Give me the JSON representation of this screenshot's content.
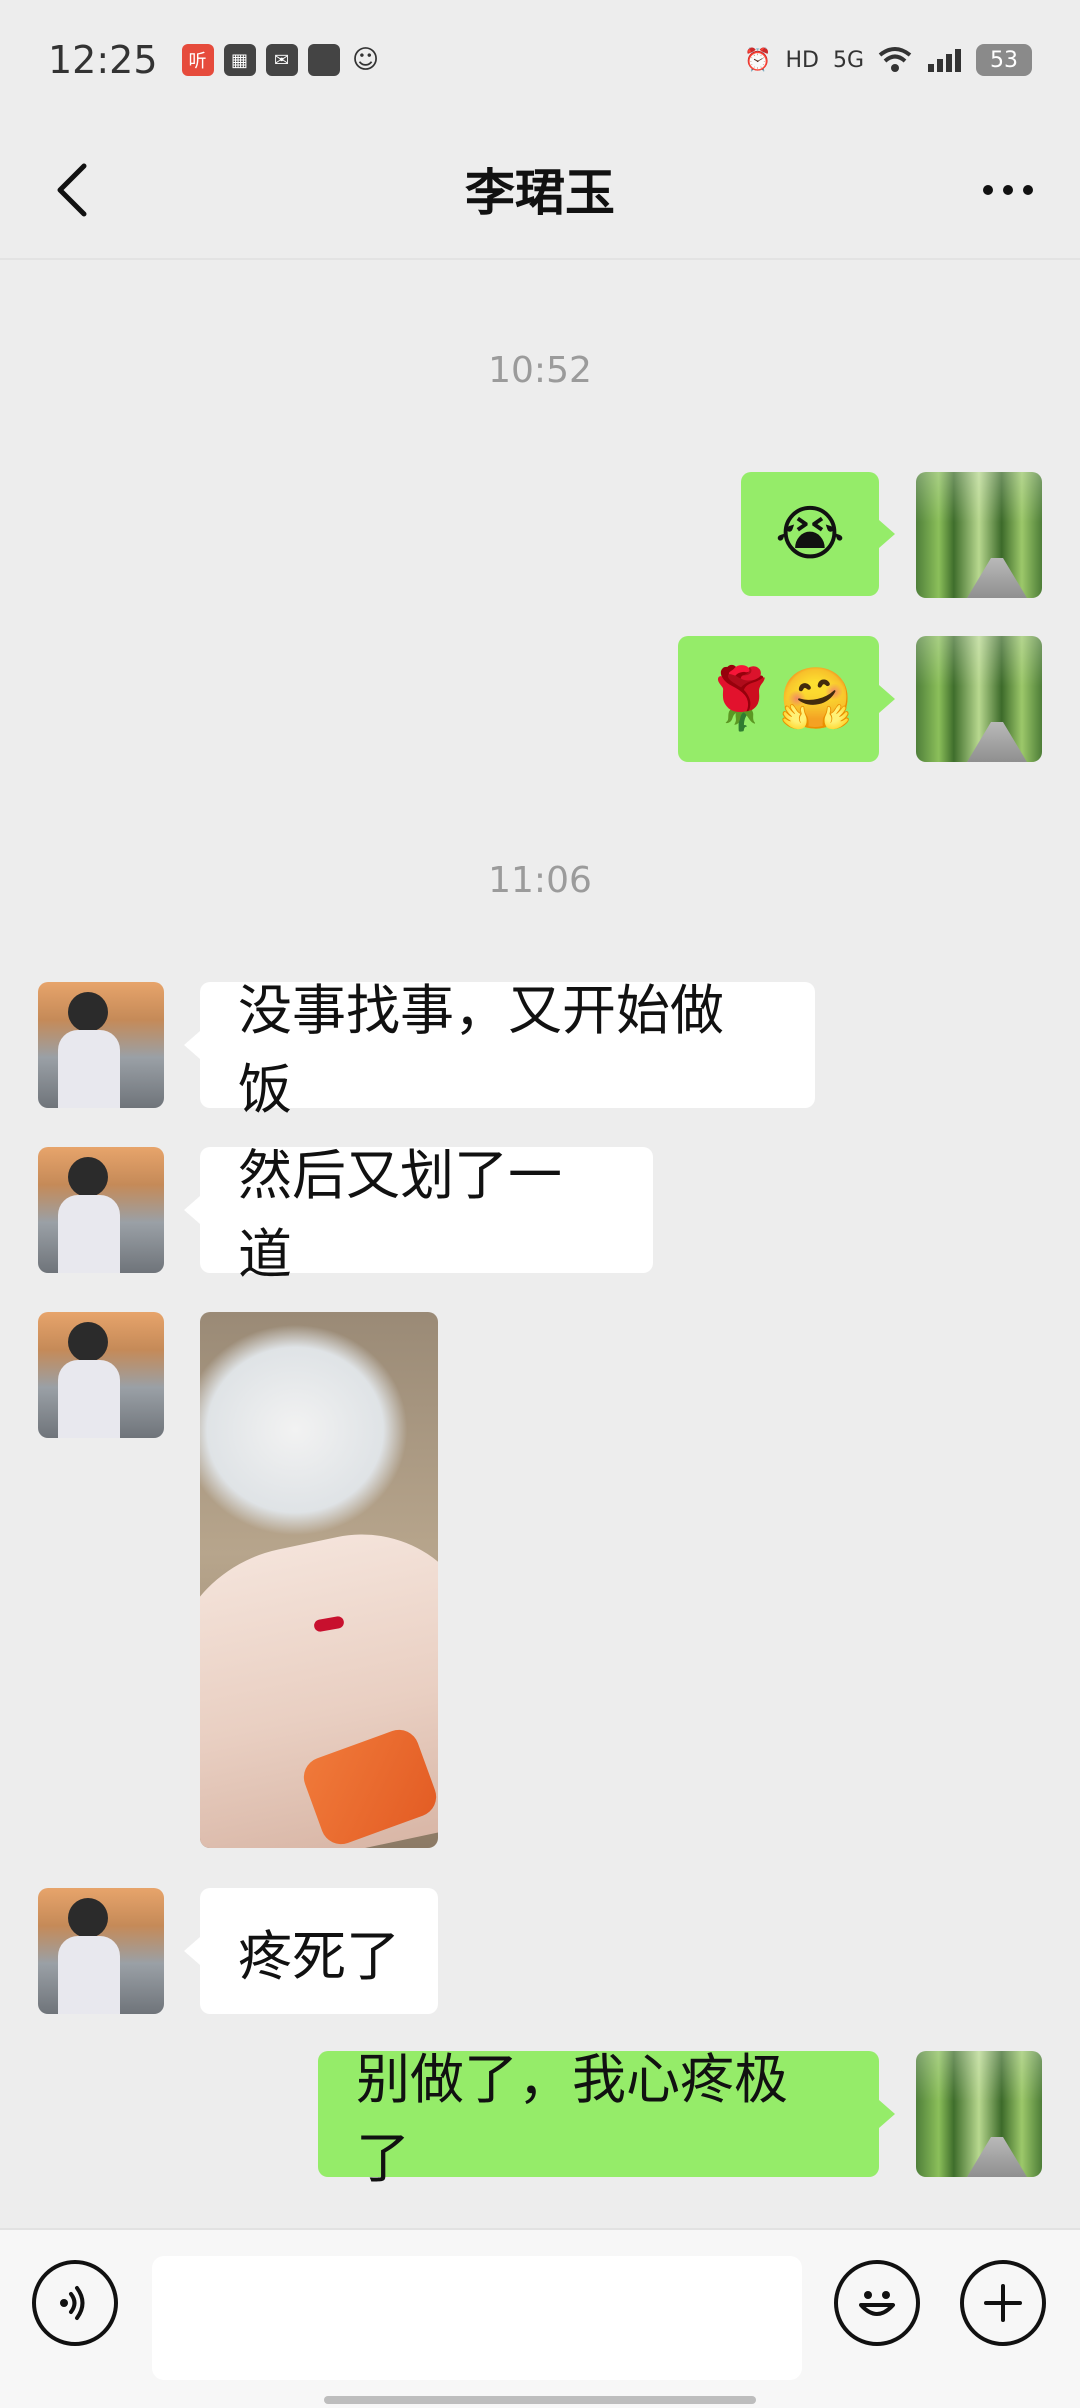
{
  "status_bar": {
    "time": "12:25",
    "left_icons": [
      "listen-app-icon",
      "app-icon",
      "notification-icon",
      "notification-icon",
      "wechat-icon"
    ],
    "right_icons": [
      "alarm-icon",
      "hd-icon",
      "5g-signal-icon",
      "wifi-icon",
      "signal-icon"
    ],
    "network_label": "5G",
    "hd_label": "HD",
    "battery_level": "53"
  },
  "header": {
    "title": "李珺玉"
  },
  "conversation": {
    "timestamps": [
      "10:52",
      "11:06"
    ],
    "messages": [
      {
        "from": "me",
        "type": "emoji",
        "content": "😭"
      },
      {
        "from": "me",
        "type": "emoji",
        "content": "🌹🤗"
      },
      {
        "from": "them",
        "type": "text",
        "content": "没事找事，又开始做饭"
      },
      {
        "from": "them",
        "type": "text",
        "content": "然后又划了一道"
      },
      {
        "from": "them",
        "type": "image",
        "content": ""
      },
      {
        "from": "them",
        "type": "text",
        "content": "疼死了"
      },
      {
        "from": "me",
        "type": "text",
        "content": "别做了，我心疼极了"
      }
    ]
  },
  "input_bar": {
    "placeholder": "",
    "buttons": [
      "voice",
      "emoji",
      "more"
    ]
  },
  "colors": {
    "background": "#ededed",
    "green_bubble": "#95ec69",
    "white_bubble": "#ffffff",
    "timestamp_text": "#9b9b9b"
  }
}
